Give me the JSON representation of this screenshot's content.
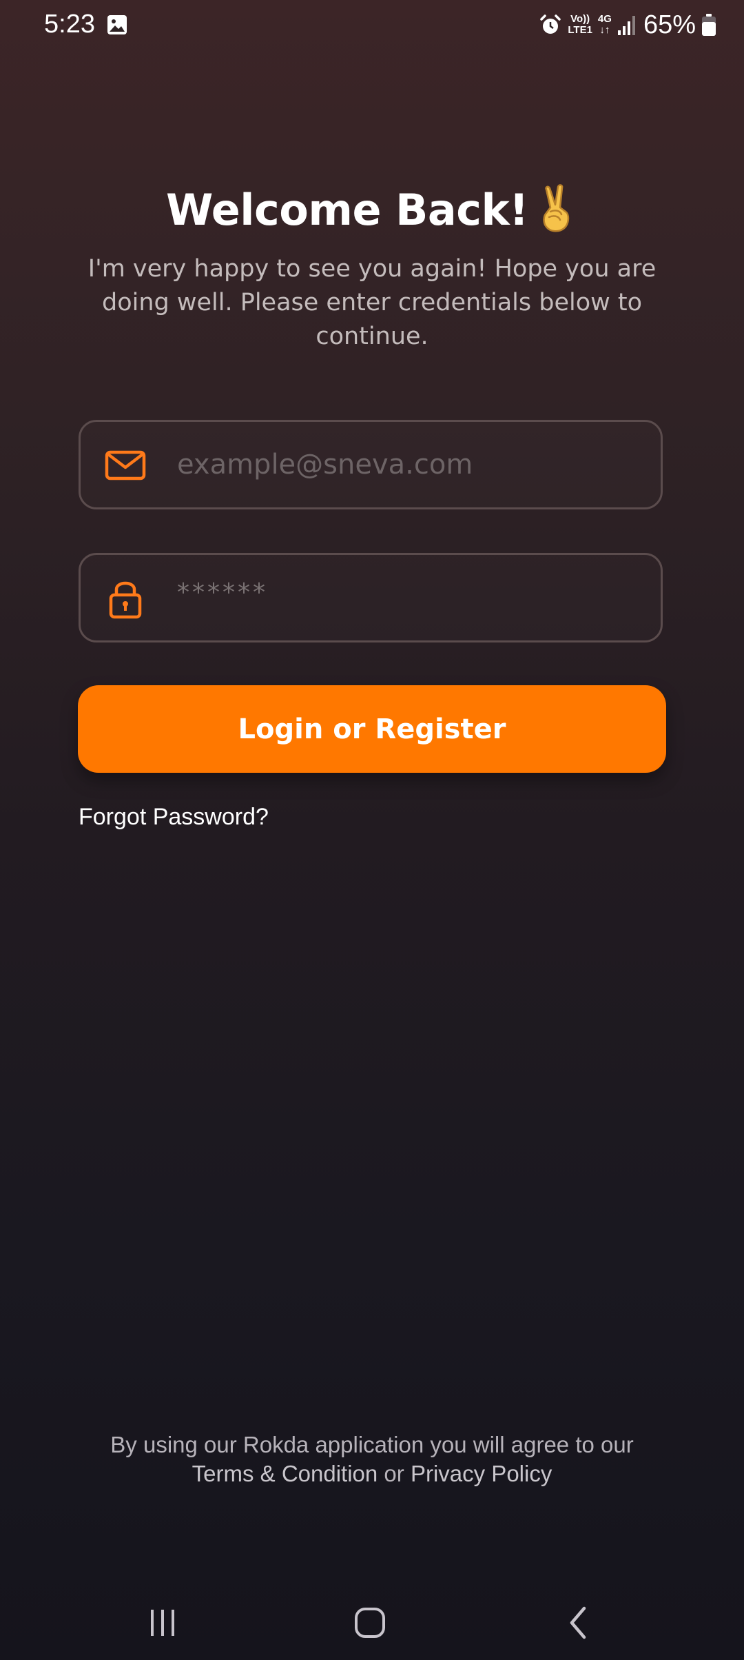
{
  "status_bar": {
    "time": "5:23",
    "network_top": "Vo))",
    "network_bottom": "LTE1",
    "data_type": "4G",
    "battery": "65%",
    "icons": [
      "gallery-icon",
      "alarm-icon",
      "signal-icon",
      "battery-icon"
    ]
  },
  "header": {
    "title": "Welcome Back!",
    "title_emoji": "peace-hand-icon",
    "subtitle": "I'm very happy to see you again! Hope you are doing well. Please enter credentials below to continue."
  },
  "form": {
    "email_placeholder": "example@sneva.com",
    "email_icon": "mail-icon",
    "password_placeholder": "******",
    "password_icon": "lock-icon",
    "submit_label": "Login or Register",
    "forgot_label": "Forgot Password?"
  },
  "footer": {
    "prefix": "By using our Rokda application you will agree to our",
    "terms_label": "Terms & Condition",
    "joiner": " or ",
    "privacy_label": "Privacy Policy"
  },
  "colors": {
    "accent": "#ff7800",
    "background_top": "#3c2527",
    "background_bottom": "#15141c",
    "field_border": "#5b4c4d"
  }
}
